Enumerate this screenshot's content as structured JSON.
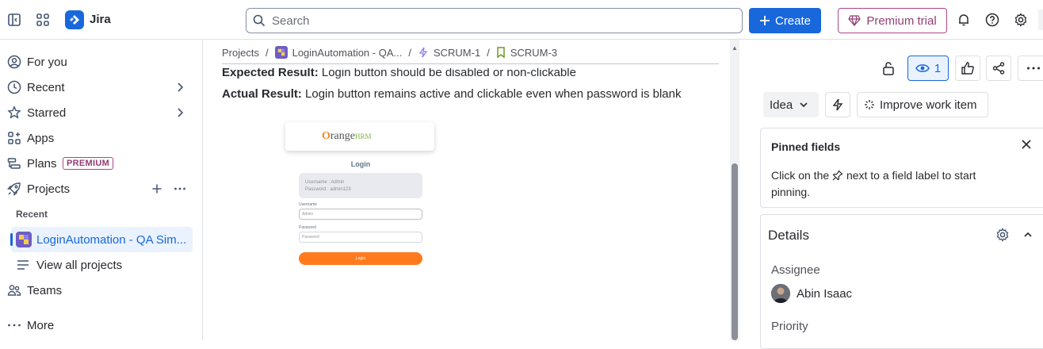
{
  "topbar": {
    "app_name": "Jira",
    "search_placeholder": "Search",
    "create_label": "Create",
    "premium_label": "Premium trial"
  },
  "sidebar": {
    "items": [
      {
        "label": "For you",
        "icon": "user-circle-icon"
      },
      {
        "label": "Recent",
        "icon": "clock-icon"
      },
      {
        "label": "Starred",
        "icon": "star-icon"
      },
      {
        "label": "Apps",
        "icon": "apps-icon"
      },
      {
        "label": "Plans",
        "icon": "plans-icon",
        "badge": "PREMIUM"
      },
      {
        "label": "Projects",
        "icon": "rocket-icon"
      }
    ],
    "recent_header": "Recent",
    "recent_project": "LoginAutomation - QA Sim...",
    "view_all": "View all projects",
    "teams": "Teams",
    "more": "More"
  },
  "breadcrumb": {
    "items": [
      "Projects",
      "LoginAutomation - QA...",
      "SCRUM-1",
      "SCRUM-3"
    ]
  },
  "description": {
    "expected_label": "Expected Result:",
    "expected_text": " Login button should be disabled or non-clickable",
    "actual_label": "Actual Result:",
    "actual_text": " Login button remains active and clickable even when password is blank"
  },
  "attachment": {
    "logo_text": "range",
    "logo_hrm": "HRM",
    "title": "Login",
    "username_hint": "Username : Admin",
    "password_hint": "Password : admin123",
    "username_label": "Username",
    "username_value": "Admin",
    "password_label": "Password",
    "password_placeholder": "Password",
    "button": "Login"
  },
  "right_panel": {
    "watch_count": "1",
    "type_label": "Idea",
    "improve_label": "Improve work item",
    "pinned_title": "Pinned fields",
    "pinned_text_1": "Click on the",
    "pinned_text_2": "next to a field label to start pinning.",
    "details_title": "Details",
    "assignee_label": "Assignee",
    "assignee_name": "Abin Isaac",
    "priority_label": "Priority"
  }
}
